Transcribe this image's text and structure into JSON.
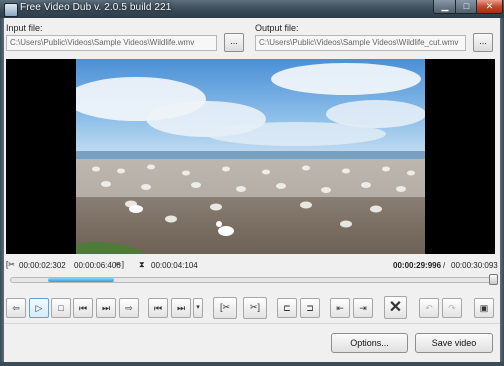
{
  "window": {
    "title": "Free Video Dub  v. 2.0.5 build 221",
    "buttons": {
      "minimize": "▁",
      "maximize": "□",
      "close": "✕"
    }
  },
  "input": {
    "label": "Input file:",
    "path": "C:\\Users\\Public\\Videos\\Sample Videos\\Wildlife.wmv",
    "browse_label": "..."
  },
  "output": {
    "label": "Output file:",
    "path": "C:\\Users\\Public\\Videos\\Sample Videos\\Wildlife_cut.wmv",
    "browse_label": "..."
  },
  "timecodes": {
    "selection_start": "00:00:02:302",
    "selection_end": "00:00:06:406",
    "selection_length": "00:00:04:104",
    "current": "00:00:29:996",
    "separator": "/",
    "total": "00:00:30:093"
  },
  "playback": {
    "progress_fraction": 0.997,
    "selection_start_fraction": 0.077,
    "selection_end_fraction": 0.213
  },
  "toolbar": {
    "buttons": [
      {
        "name": "prev-frame",
        "glyph": "⇦"
      },
      {
        "name": "play",
        "glyph": "▷"
      },
      {
        "name": "stop",
        "glyph": "□"
      },
      {
        "name": "go-start",
        "glyph": "⏮"
      },
      {
        "name": "go-end",
        "glyph": "⏭"
      },
      {
        "name": "next-frame",
        "glyph": "⇨"
      },
      {
        "name": "prev-keyframe",
        "glyph": "⏮"
      },
      {
        "name": "next-keyframe",
        "glyph": "⏭"
      },
      {
        "name": "step-dropdown",
        "glyph": "▾"
      },
      {
        "name": "set-start-mark",
        "glyph": "[✂"
      },
      {
        "name": "set-end-mark",
        "glyph": "✂]"
      },
      {
        "name": "go-mark-start",
        "glyph": "⊏"
      },
      {
        "name": "go-mark-end",
        "glyph": "⊐"
      },
      {
        "name": "prev-cut",
        "glyph": "⇤"
      },
      {
        "name": "next-cut",
        "glyph": "⇥"
      },
      {
        "name": "delete-selection",
        "glyph": "✕"
      },
      {
        "name": "undo",
        "glyph": "↶"
      },
      {
        "name": "redo",
        "glyph": "↷"
      },
      {
        "name": "toggle-view",
        "glyph": "▣"
      }
    ]
  },
  "footer": {
    "options_label": "Options...",
    "save_label": "Save video"
  }
}
